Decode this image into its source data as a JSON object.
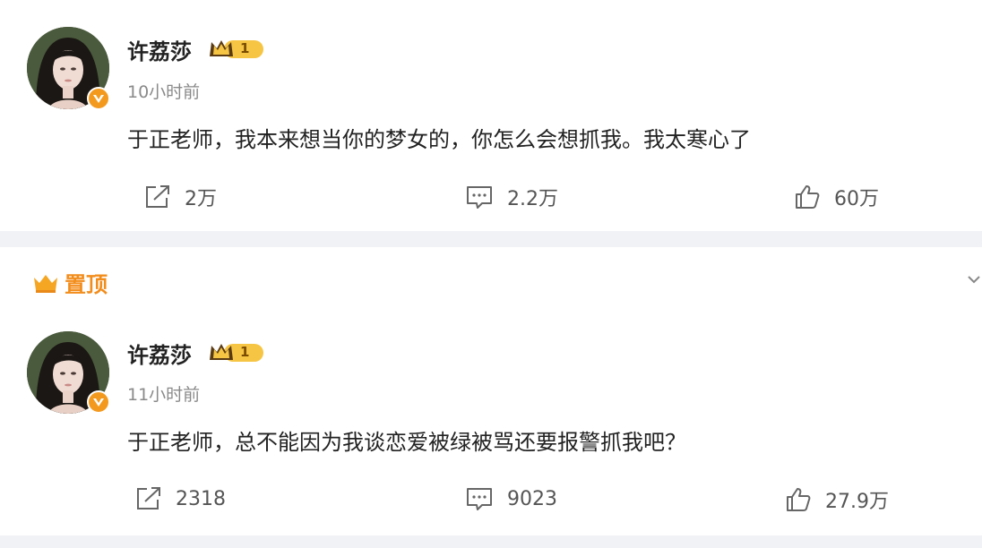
{
  "pinned_label": "置顶",
  "posts": [
    {
      "author": "许荔莎",
      "level": "1",
      "time": "10小时前",
      "text": "于正老师，我本来想当你的梦女的，你怎么会想抓我。我太寒心了",
      "repost_count": "2万",
      "comment_count": "2.2万",
      "like_count": "60万"
    },
    {
      "author": "许荔莎",
      "level": "1",
      "time": "11小时前",
      "text": "于正老师，总不能因为我谈恋爱被绿被骂还要报警抓我吧？",
      "repost_count": "2318",
      "comment_count": "9023",
      "like_count": "27.9万"
    }
  ],
  "colors": {
    "accent": "#f28d1c",
    "background": "#f1f2f5",
    "badge_gold": "#f6c544"
  },
  "icons": [
    "repost-icon",
    "comment-icon",
    "like-icon",
    "verified-icon",
    "crown-level-icon",
    "pin-crown-icon",
    "chevron-down-icon"
  ]
}
